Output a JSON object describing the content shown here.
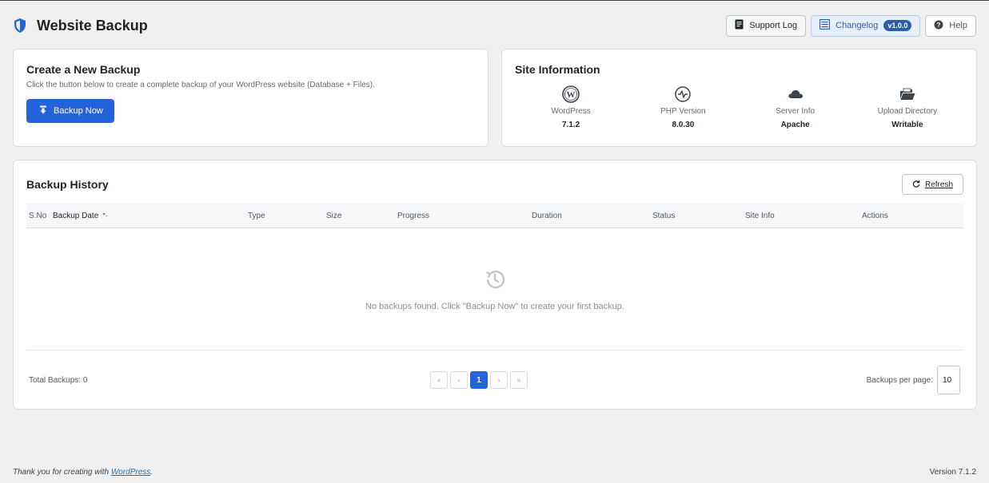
{
  "header": {
    "title": "Website Backup",
    "support_log": "Support Log",
    "changelog": "Changelog",
    "version_badge": "v1.0.0",
    "help": "Help"
  },
  "create": {
    "title": "Create a New Backup",
    "description": "Click the button below to create a complete backup of your WordPress website (Database + Files).",
    "button": "Backup Now"
  },
  "site_info": {
    "title": "Site Information",
    "items": [
      {
        "label": "WordPress",
        "value": "7.1.2",
        "icon": "wordpress-icon"
      },
      {
        "label": "PHP Version",
        "value": "8.0.30",
        "icon": "activity-icon"
      },
      {
        "label": "Server Info",
        "value": "Apache",
        "icon": "cloud-icon"
      },
      {
        "label": "Upload Directory",
        "value": "Writable",
        "icon": "folder-open-icon"
      }
    ]
  },
  "history": {
    "title": "Backup History",
    "refresh": "Refresh",
    "columns": [
      "S.No",
      "Backup Date",
      "Type",
      "Size",
      "Progress",
      "Duration",
      "Status",
      "Site Info",
      "Actions"
    ],
    "empty_text": "No backups found. Click \"Backup Now\" to create your first backup.",
    "total": "Total Backups: 0",
    "pager": {
      "first": "«",
      "prev": "‹",
      "current": "1",
      "next": "›",
      "last": "»"
    },
    "per_page_label": "Backups per page:",
    "per_page_value": "10"
  },
  "footer": {
    "thanks_prefix": "Thank you for creating with ",
    "thanks_link": "WordPress",
    "thanks_suffix": ".",
    "version": "Version 7.1.2"
  },
  "colors": {
    "primary": "#2563db",
    "badge": "#2c5ea8",
    "background": "#f0f0f1"
  }
}
